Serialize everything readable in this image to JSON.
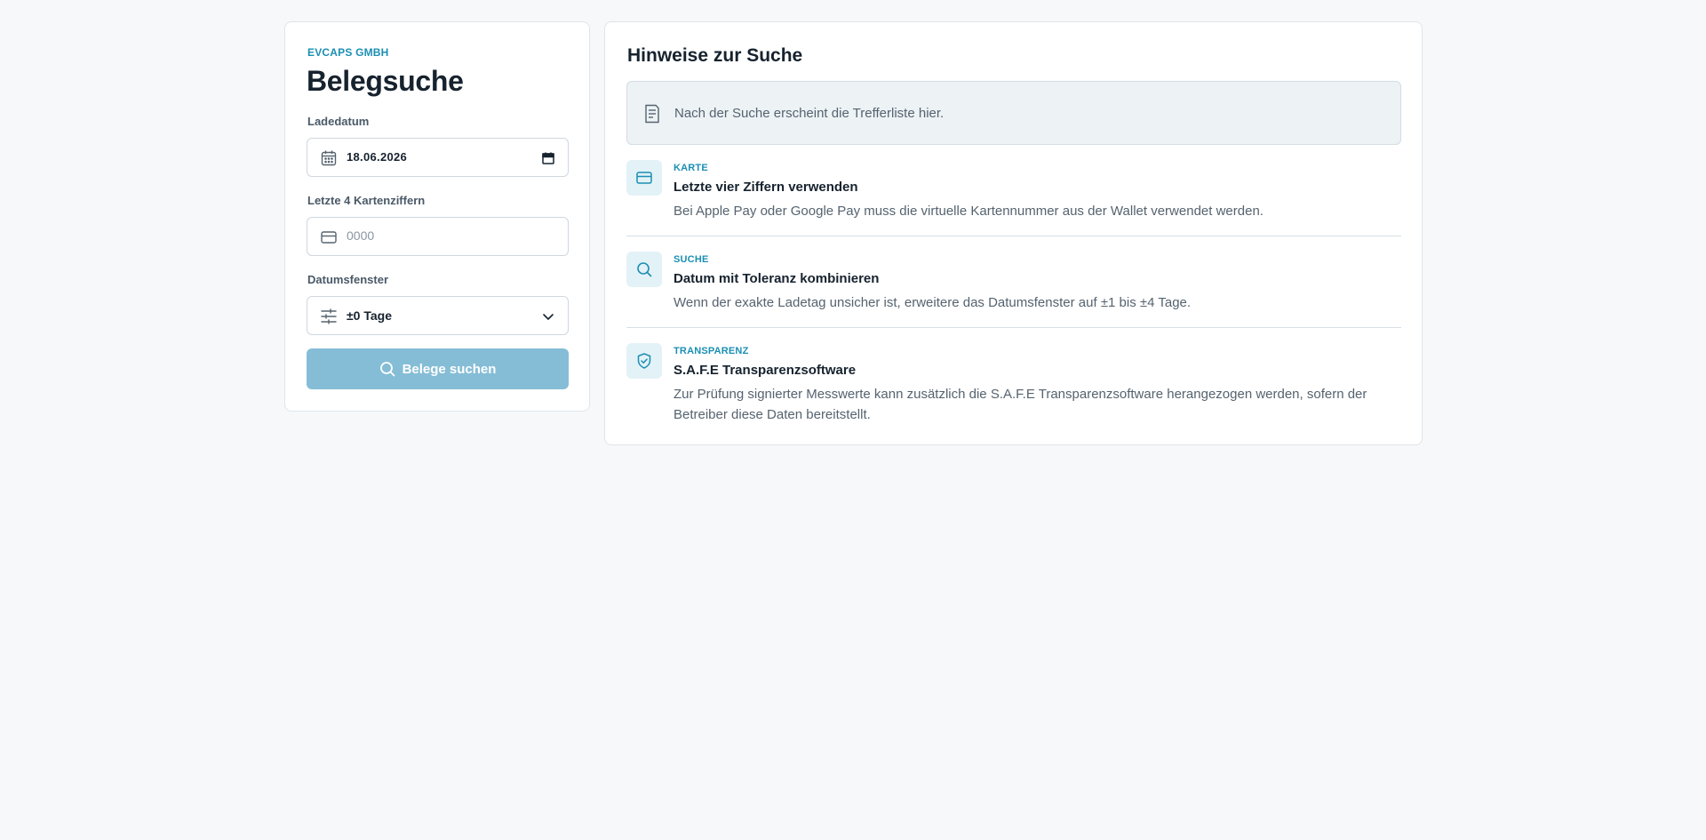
{
  "search": {
    "brand": "EVCAPS GMBH",
    "title": "Belegsuche",
    "date_label": "Ladedatum",
    "date_value": "18.06.2026",
    "card_label": "Letzte 4 Kartenziffern",
    "card_placeholder": "0000",
    "window_label": "Datumsfenster",
    "window_value": "±0 Tage",
    "submit_label": "Belege suchen"
  },
  "hints": {
    "title": "Hinweise zur Suche",
    "empty_text": "Nach der Suche erscheint die Trefferliste hier.",
    "items": [
      {
        "tag": "KARTE",
        "title": "Letzte vier Ziffern verwenden",
        "text": "Bei Apple Pay oder Google Pay muss die virtuelle Kartennummer aus der Wallet verwendet werden.",
        "icon": "credit-card-icon"
      },
      {
        "tag": "SUCHE",
        "title": "Datum mit Toleranz kombinieren",
        "text": "Wenn der exakte Ladetag unsicher ist, erweitere das Datumsfenster auf ±1 bis ±4 Tage.",
        "icon": "search-icon"
      },
      {
        "tag": "TRANSPARENZ",
        "title": "S.A.F.E Transparenzsoftware",
        "text": "Zur Prüfung signierter Messwerte kann zusätzlich die S.A.F.E Transparenzsoftware herangezogen werden, sofern der Betreiber diese Daten bereitstellt.",
        "icon": "shield-check-icon"
      }
    ]
  },
  "colors": {
    "accent": "#1b8fb3",
    "button_disabled": "#85bdd6",
    "page_background": "#f6f8fa"
  }
}
